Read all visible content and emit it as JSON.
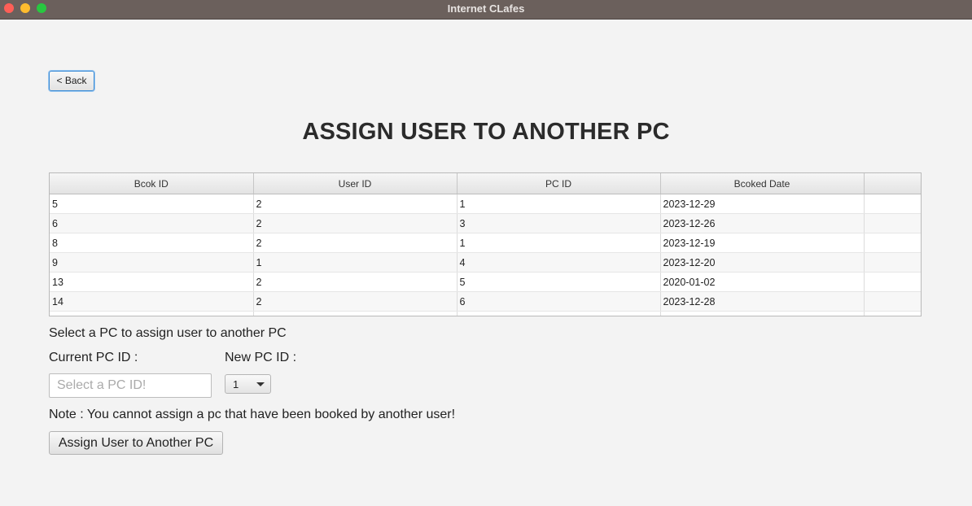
{
  "window": {
    "title": "Internet CLafes"
  },
  "back_button": {
    "label": "< Back"
  },
  "page_title": "ASSIGN USER TO ANOTHER PC",
  "table": {
    "columns": [
      "Bcok ID",
      "User ID",
      "PC ID",
      "Bcoked Date",
      ""
    ],
    "rows": [
      [
        "5",
        "2",
        "1",
        "2023-12-29",
        ""
      ],
      [
        "6",
        "2",
        "3",
        "2023-12-26",
        ""
      ],
      [
        "8",
        "2",
        "1",
        "2023-12-19",
        ""
      ],
      [
        "9",
        "1",
        "4",
        "2023-12-20",
        ""
      ],
      [
        "13",
        "2",
        "5",
        "2020-01-02",
        ""
      ],
      [
        "14",
        "2",
        "6",
        "2023-12-28",
        ""
      ]
    ]
  },
  "form": {
    "instruction": "Select a PC to assign user to another PC",
    "current_pc_label": "Current PC ID :",
    "current_pc_value": "",
    "current_pc_placeholder": "Select a PC ID!",
    "new_pc_label": "New PC ID :",
    "new_pc_selected": "1",
    "note": "Note : You cannot assign a pc that have been booked by another user!",
    "assign_button_label": "Assign User to Another PC"
  },
  "colors": {
    "titlebar": "#6b605c",
    "focus_accent": "#3a8bd6"
  }
}
